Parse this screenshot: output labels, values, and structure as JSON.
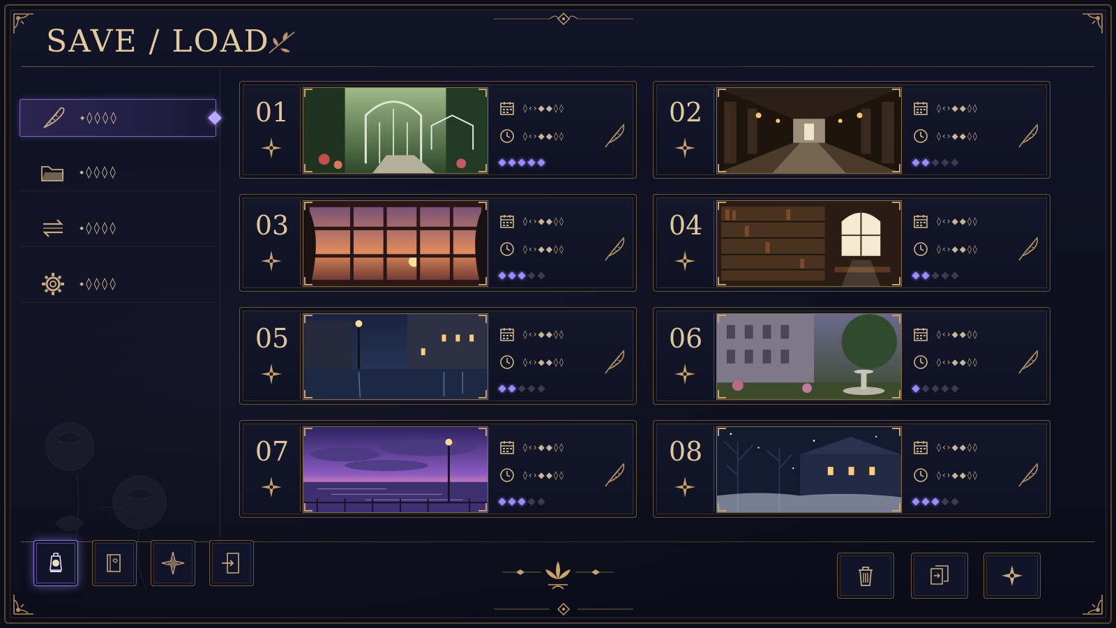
{
  "header": {
    "title": "SAVE / LOAD"
  },
  "sidebar": {
    "items": [
      {
        "icon": "quill-icon",
        "label": "⬩◊◊◊◊",
        "active": true
      },
      {
        "icon": "folder-icon",
        "label": "⬩◊◊◊◊",
        "active": false
      },
      {
        "icon": "swap-arrows-icon",
        "label": "⬩◊◊◊◊",
        "active": false
      },
      {
        "icon": "gear-icon",
        "label": "⬩◊◊◊◊",
        "active": false
      }
    ]
  },
  "slots": [
    {
      "number": "01",
      "scene": "garden-gazebo",
      "date": "◊‹›◆◆◊◊",
      "time": "◊‹›◆◆◊◊",
      "gems_on": 5,
      "gems_total": 5
    },
    {
      "number": "02",
      "scene": "corridor",
      "date": "◊‹›◆◆◊◊",
      "time": "◊‹›◆◆◊◊",
      "gems_on": 2,
      "gems_total": 5
    },
    {
      "number": "03",
      "scene": "sunset-window",
      "date": "◊‹›◆◆◊◊",
      "time": "◊‹›◆◆◊◊",
      "gems_on": 3,
      "gems_total": 5
    },
    {
      "number": "04",
      "scene": "library",
      "date": "◊‹›◆◆◊◊",
      "time": "◊‹›◆◆◊◊",
      "gems_on": 2,
      "gems_total": 5
    },
    {
      "number": "05",
      "scene": "rainy-street",
      "date": "◊‹›◆◆◊◊",
      "time": "◊‹›◆◆◊◊",
      "gems_on": 2,
      "gems_total": 5
    },
    {
      "number": "06",
      "scene": "courtyard-fountain",
      "date": "◊‹›◆◆◊◊",
      "time": "◊‹›◆◆◊◊",
      "gems_on": 1,
      "gems_total": 5
    },
    {
      "number": "07",
      "scene": "twilight-lake",
      "date": "◊‹›◆◆◊◊",
      "time": "◊‹›◆◆◊◊",
      "gems_on": 3,
      "gems_total": 5
    },
    {
      "number": "08",
      "scene": "snowy-night",
      "date": "◊‹›◆◆◊◊",
      "time": "◊‹›◆◆◊◊",
      "gems_on": 3,
      "gems_total": 5
    }
  ],
  "toolbar": {
    "left": [
      {
        "icon": "lantern-icon",
        "active": true
      },
      {
        "icon": "book-icon",
        "active": false
      },
      {
        "icon": "compass-star-icon",
        "active": false
      },
      {
        "icon": "exit-door-icon",
        "active": false
      }
    ],
    "right": [
      {
        "icon": "trash-icon"
      },
      {
        "icon": "copy-icon"
      },
      {
        "icon": "sparkle-icon"
      }
    ]
  },
  "colors": {
    "accent_gold": "#d7b98a",
    "gem_active": "#9e8cff",
    "background": "#0d0f1d"
  }
}
